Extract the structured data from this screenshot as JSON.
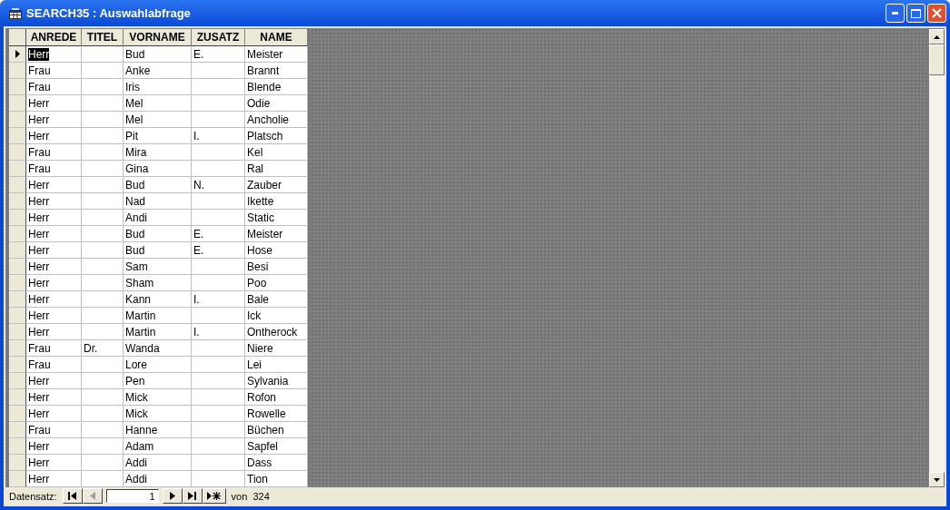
{
  "window": {
    "title": "SEARCH35 : Auswahlabfrage"
  },
  "table": {
    "columns": [
      "ANREDE",
      "TITEL",
      "VORNAME",
      "ZUSATZ",
      "NAME"
    ],
    "rows": [
      {
        "selected": true,
        "cells": [
          "Herr",
          "",
          "Bud",
          "E.",
          "Meister"
        ]
      },
      {
        "selected": false,
        "cells": [
          "Frau",
          "",
          "Anke",
          "",
          "Brannt"
        ]
      },
      {
        "selected": false,
        "cells": [
          "Frau",
          "",
          "Iris",
          "",
          "Blende"
        ]
      },
      {
        "selected": false,
        "cells": [
          "Herr",
          "",
          "Mel",
          "",
          "Odie"
        ]
      },
      {
        "selected": false,
        "cells": [
          "Herr",
          "",
          "Mel",
          "",
          "Ancholie"
        ]
      },
      {
        "selected": false,
        "cells": [
          "Herr",
          "",
          "Pit",
          "I.",
          "Platsch"
        ]
      },
      {
        "selected": false,
        "cells": [
          "Frau",
          "",
          "Mira",
          "",
          "Kel"
        ]
      },
      {
        "selected": false,
        "cells": [
          "Frau",
          "",
          "Gina",
          "",
          "Ral"
        ]
      },
      {
        "selected": false,
        "cells": [
          "Herr",
          "",
          "Bud",
          "N.",
          "Zauber"
        ]
      },
      {
        "selected": false,
        "cells": [
          "Herr",
          "",
          "Nad",
          "",
          "Ikette"
        ]
      },
      {
        "selected": false,
        "cells": [
          "Herr",
          "",
          "Andi",
          "",
          "Static"
        ]
      },
      {
        "selected": false,
        "cells": [
          "Herr",
          "",
          "Bud",
          "E.",
          "Meister"
        ]
      },
      {
        "selected": false,
        "cells": [
          "Herr",
          "",
          "Bud",
          "E.",
          "Hose"
        ]
      },
      {
        "selected": false,
        "cells": [
          "Herr",
          "",
          "Sam",
          "",
          "Besi"
        ]
      },
      {
        "selected": false,
        "cells": [
          "Herr",
          "",
          "Sham",
          "",
          "Poo"
        ]
      },
      {
        "selected": false,
        "cells": [
          "Herr",
          "",
          "Kann",
          "I.",
          "Bale"
        ]
      },
      {
        "selected": false,
        "cells": [
          "Herr",
          "",
          "Martin",
          "",
          "Ick"
        ]
      },
      {
        "selected": false,
        "cells": [
          "Herr",
          "",
          "Martin",
          "I.",
          "Ontherock"
        ]
      },
      {
        "selected": false,
        "cells": [
          "Frau",
          "Dr.",
          "Wanda",
          "",
          "Niere"
        ]
      },
      {
        "selected": false,
        "cells": [
          "Frau",
          "",
          "Lore",
          "",
          "Lei"
        ]
      },
      {
        "selected": false,
        "cells": [
          "Herr",
          "",
          "Pen",
          "",
          "Sylvania"
        ]
      },
      {
        "selected": false,
        "cells": [
          "Herr",
          "",
          "Mick",
          "",
          "Rofon"
        ]
      },
      {
        "selected": false,
        "cells": [
          "Herr",
          "",
          "Mick",
          "",
          "Rowelle"
        ]
      },
      {
        "selected": false,
        "cells": [
          "Frau",
          "",
          "Hanne",
          "",
          "Büchen"
        ]
      },
      {
        "selected": false,
        "cells": [
          "Herr",
          "",
          "Adam",
          "",
          "Sapfel"
        ]
      },
      {
        "selected": false,
        "cells": [
          "Herr",
          "",
          "Addi",
          "",
          "Dass"
        ]
      },
      {
        "selected": false,
        "cells": [
          "Herr",
          "",
          "Addi",
          "",
          "Tion"
        ]
      }
    ]
  },
  "navigator": {
    "label": "Datensatz:",
    "record": "1",
    "total": "von  324",
    "buttons": [
      {
        "kind": "first",
        "disabled": false
      },
      {
        "kind": "prev",
        "disabled": true
      },
      {
        "kind": "next",
        "disabled": false
      },
      {
        "kind": "last",
        "disabled": false
      },
      {
        "kind": "new",
        "disabled": false
      }
    ]
  }
}
